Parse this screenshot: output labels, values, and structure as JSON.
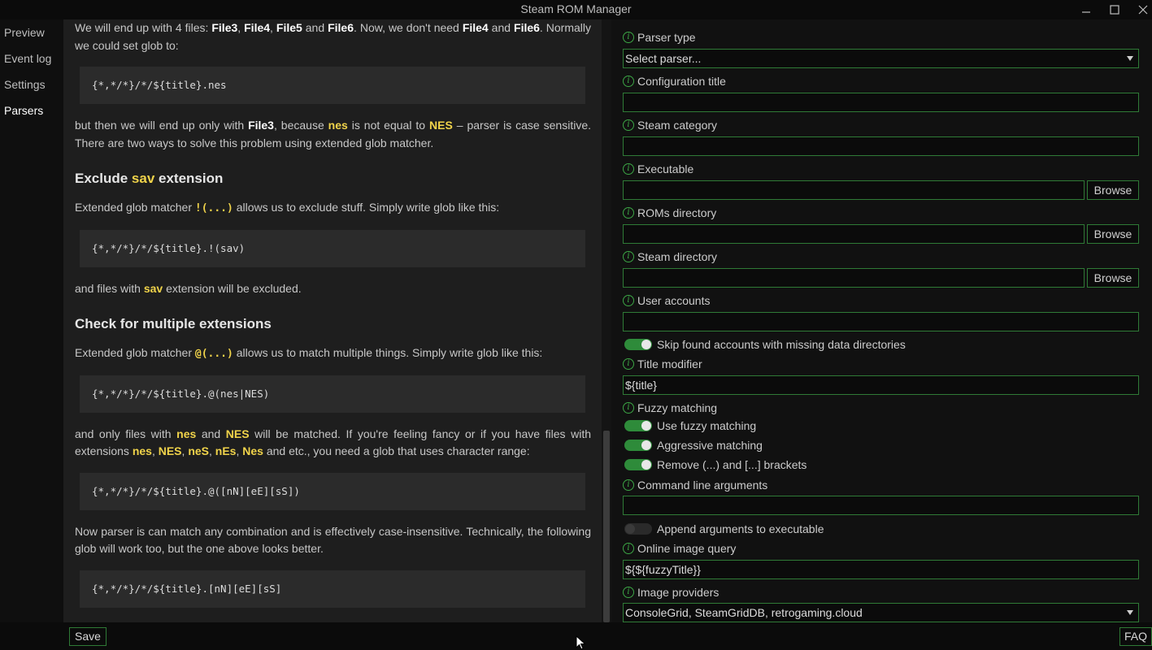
{
  "window": {
    "title": "Steam ROM Manager"
  },
  "nav": {
    "items": [
      {
        "label": "Preview"
      },
      {
        "label": "Event log"
      },
      {
        "label": "Settings"
      },
      {
        "label": "Parsers",
        "active": true
      }
    ]
  },
  "doc": {
    "p1": {
      "a": "We will end up with 4 files: ",
      "f3": "File3",
      "c1": ", ",
      "f4": "File4",
      "c2": ", ",
      "f5": "File5",
      "c3": " and ",
      "f6": "File6",
      "c4": ". Now, we don't need ",
      "f4b": "File4",
      "c5": " and ",
      "f6b": "File6",
      "c6": ". Normally we could set glob to:"
    },
    "code1": "{*,*/*}/*/${title}.nes",
    "p2": {
      "a": "but then we will end up only with ",
      "f3": "File3",
      "b": ", because ",
      "nes": "nes",
      "c": " is not equal to ",
      "NES": "NES",
      "d": " – parser is case sensitive. There are two ways to solve this problem using extended glob matcher."
    },
    "h1": {
      "a": "Exclude ",
      "hl": "sav",
      "b": " extension"
    },
    "p3": {
      "a": "Extended glob matcher ",
      "code": "!(...)",
      "b": " allows us to exclude stuff. Simply write glob like this:"
    },
    "code2": "{*,*/*}/*/${title}.!(sav)",
    "p4": {
      "a": "and files with ",
      "hl": "sav",
      "b": " extension will be excluded."
    },
    "h2": "Check for multiple extensions",
    "p5": {
      "a": "Extended glob matcher ",
      "code": "@(...)",
      "b": " allows us to match multiple things. Simply write glob like this:"
    },
    "code3": "{*,*/*}/*/${title}.@(nes|NES)",
    "p6": {
      "a": "and only files with ",
      "nes": "nes",
      "b": " and ",
      "NES": "NES",
      "c": " will be matched. If you're feeling fancy or if you have files with extensions ",
      "e1": "nes",
      "s1": ", ",
      "e2": "NES",
      "s2": ", ",
      "e3": "neS",
      "s3": ", ",
      "e4": "nEs",
      "s4": ", ",
      "e5": "Nes",
      "d": " and etc., you need a glob that uses character range:"
    },
    "code4": "{*,*/*}/*/${title}.@([nN][eE][sS])",
    "p7": "Now parser is can match any combination and is effectively case-insensitive. Technically, the following glob will work too, but the one above looks better.",
    "code5": "{*,*/*}/*/${title}.[nN][eE][sS]"
  },
  "config": {
    "parser_type": {
      "label": "Parser type",
      "value": "Select parser..."
    },
    "config_title": {
      "label": "Configuration title",
      "value": ""
    },
    "steam_category": {
      "label": "Steam category",
      "value": ""
    },
    "executable": {
      "label": "Executable",
      "value": "",
      "browse": "Browse"
    },
    "roms_dir": {
      "label": "ROMs directory",
      "value": "",
      "browse": "Browse"
    },
    "steam_dir": {
      "label": "Steam directory",
      "value": "",
      "browse": "Browse"
    },
    "user_accounts": {
      "label": "User accounts",
      "value": ""
    },
    "skip_accounts": {
      "label": "Skip found accounts with missing data directories",
      "on": true
    },
    "title_modifier": {
      "label": "Title modifier",
      "value": "${title}"
    },
    "fuzzy": {
      "label": "Fuzzy matching",
      "use": {
        "label": "Use fuzzy matching",
        "on": true
      },
      "aggressive": {
        "label": "Aggressive matching",
        "on": true
      },
      "remove": {
        "label": "Remove (...) and [...] brackets",
        "on": true
      }
    },
    "cmd_args": {
      "label": "Command line arguments",
      "value": ""
    },
    "append_args": {
      "label": "Append arguments to executable",
      "on": false
    },
    "image_query": {
      "label": "Online image query",
      "value": "${${fuzzyTitle}}"
    },
    "image_providers": {
      "label": "Image providers",
      "value": "ConsoleGrid, SteamGridDB, retrogaming.cloud"
    }
  },
  "footer": {
    "save": "Save",
    "faq": "FAQ"
  },
  "colors": {
    "accent": "#2e8b3a",
    "highlight": "#f0d34a",
    "border": "#2f7a36"
  }
}
